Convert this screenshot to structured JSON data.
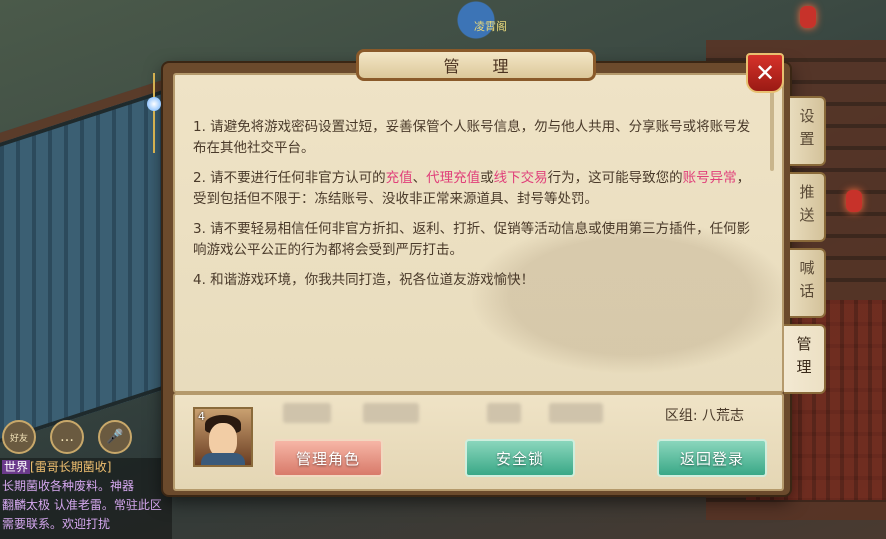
{
  "scene": {
    "npc_name": "凌霄阁"
  },
  "dialog": {
    "title": "管 理",
    "close_label": "✕",
    "rules": [
      {
        "parts": [
          {
            "t": "1. 请避免将游戏密码设置过短，妥善保管个人账号信息，勿与他人共用、分享账号或将账号发布在其他社交平台。"
          }
        ]
      },
      {
        "parts": [
          {
            "t": "2. 请不要进行任何非官方认可的"
          },
          {
            "t": "充值",
            "hl": true
          },
          {
            "t": "、"
          },
          {
            "t": "代理充值",
            "hl": true
          },
          {
            "t": "或"
          },
          {
            "t": "线下交易",
            "hl": true
          },
          {
            "t": "行为，这可能导致您的"
          },
          {
            "t": "账号异常",
            "hl": true
          },
          {
            "t": "，受到包括但不限于：冻结账号、没收非正常来源道具、封号等处罚。"
          }
        ]
      },
      {
        "parts": [
          {
            "t": "3. 请不要轻易相信任何非官方折扣、返利、打折、促销等活动信息或使用第三方插件，任何影响游戏公平公正的行为都将会受到严厉打击。"
          }
        ]
      },
      {
        "parts": [
          {
            "t": "4. 和谐游戏环境，你我共同打造，祝各位道友游戏愉快！"
          }
        ]
      }
    ],
    "character": {
      "level": "4",
      "zone_label": "区组: 八荒志"
    },
    "buttons": {
      "manage_role": "管理角色",
      "security_lock": "安全锁",
      "back_to_login": "返回登录"
    }
  },
  "tabs": [
    {
      "label": "设置",
      "active": false
    },
    {
      "label": "推送",
      "active": false
    },
    {
      "label": "喊话",
      "active": false
    },
    {
      "label": "管理",
      "active": true
    }
  ],
  "chat": {
    "icons": [
      "好友",
      "…",
      "🎤"
    ],
    "lines": [
      {
        "channel": "世界",
        "text": "[雷哥长期菌收]"
      },
      {
        "text": "长期菌收各种废料。神器"
      },
      {
        "text": "翻麟太极 认准老雷。常驻此区"
      },
      {
        "text": "需要联系。欢迎打扰"
      }
    ]
  },
  "colors": {
    "highlight": "#e0407a",
    "text": "#4a3a2a",
    "title_frame": "#8a5a2a",
    "close_red": "#d6322a",
    "green_button": "#3aa887",
    "pink_button": "#d87a6a"
  }
}
